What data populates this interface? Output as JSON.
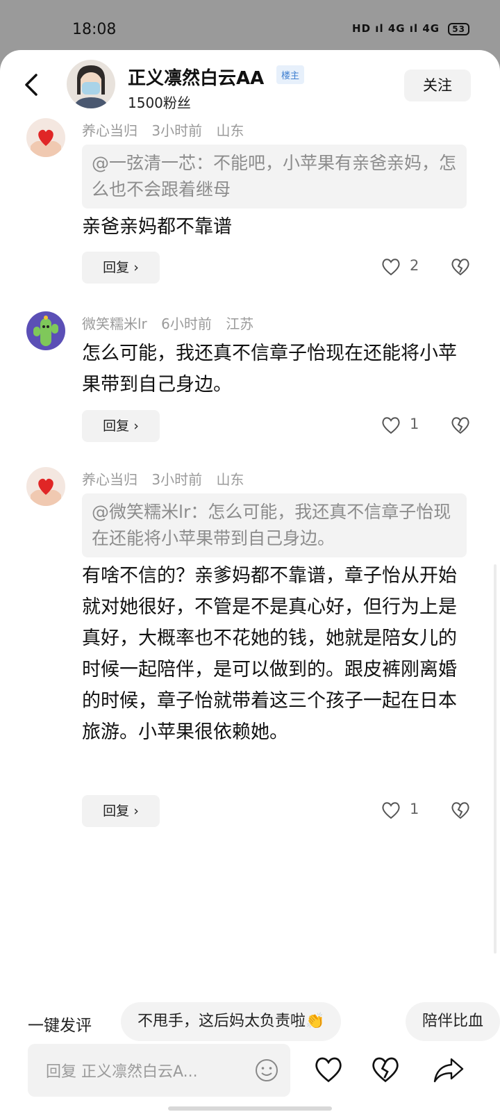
{
  "status": {
    "time": "18:08",
    "network": "HD",
    "signal1": "4G",
    "signal2": "4G",
    "battery": "53"
  },
  "header": {
    "name": "正义凛然白云AA",
    "badge": "楼主",
    "fans": "1500粉丝",
    "follow_label": "关注"
  },
  "comments": [
    {
      "user": "养心当归",
      "time": "3小时前",
      "location": "山东",
      "quote": "@一弦清一芯：不能吧，小苹果有亲爸亲妈，怎么也不会跟着继母",
      "text": "亲爸亲妈都不靠谱",
      "reply_label": "回复",
      "likes": "2"
    },
    {
      "user": "微笑糯米lr",
      "time": "6小时前",
      "location": "江苏",
      "text": "怎么可能，我还真不信章子怡现在还能将小苹果带到自己身边。",
      "reply_label": "回复",
      "likes": "1"
    },
    {
      "user": "养心当归",
      "time": "3小时前",
      "location": "山东",
      "quote": "@微笑糯米lr：怎么可能，我还真不信章子怡现在还能将小苹果带到自己身边。",
      "text": "有啥不信的？亲爹妈都不靠谱，章子怡从开始就对她很好，不管是不是真心好，但行为上是真好，大概率也不花她的钱，她就是陪女儿的时候一起陪伴，是可以做到的。跟皮裤刚离婚的时候，章子怡就带着这三个孩子一起在日本旅游。小苹果很依赖她。",
      "reply_label": "回复",
      "likes": "1"
    }
  ],
  "suggest": {
    "label": "一键发评",
    "chips": [
      "不甩手，这后妈太负责啦👏",
      "陪伴比血"
    ]
  },
  "input": {
    "placeholder": "回复 正义凛然白云A..."
  },
  "colors": {
    "meta_gray": "#9a9a9a",
    "badge_blue": "#3f7fd0",
    "quote_bg": "#f3f3f3"
  }
}
